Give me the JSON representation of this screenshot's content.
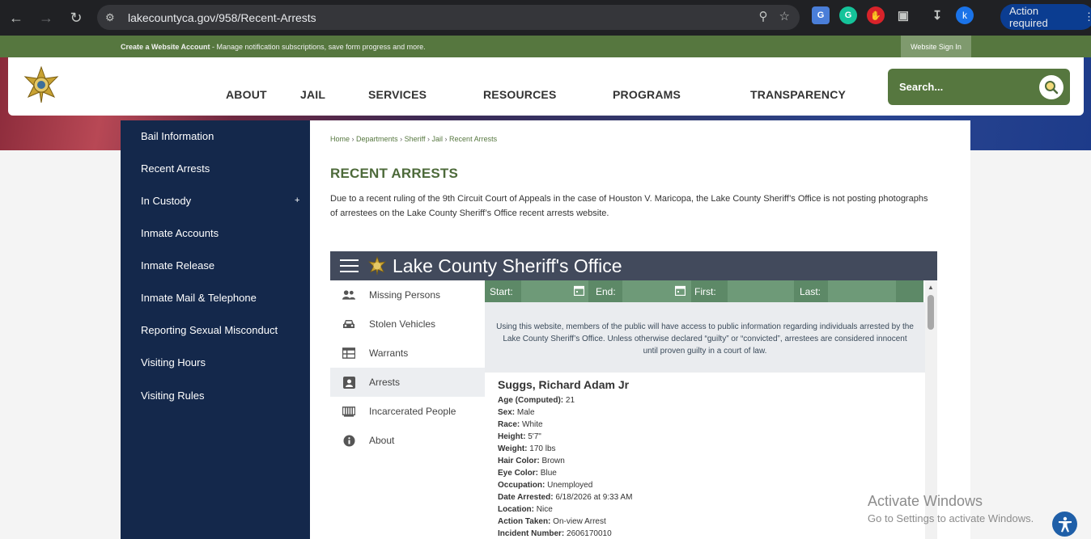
{
  "browser": {
    "url": "lakecountyca.gov/958/Recent-Arrests",
    "avatar_letter": "k",
    "action_required": "Action required"
  },
  "account_bar": {
    "create_bold": "Create a Website Account",
    "create_rest": " - Manage notification subscriptions, save form progress and more.",
    "sign_in": "Website Sign In"
  },
  "nav": {
    "about": "ABOUT",
    "jail": "JAIL",
    "services": "SERVICES",
    "resources": "RESOURCES",
    "programs": "PROGRAMS",
    "transparency": "TRANSPARENCY",
    "search_placeholder": "Search..."
  },
  "sidebar": {
    "items": [
      {
        "label": "Bail Information"
      },
      {
        "label": "Recent Arrests"
      },
      {
        "label": "In Custody",
        "expander": "+"
      },
      {
        "label": "Inmate Accounts"
      },
      {
        "label": "Inmate Release"
      },
      {
        "label": "Inmate Mail & Telephone"
      },
      {
        "label": "Reporting Sexual Misconduct"
      },
      {
        "label": "Visiting Hours"
      },
      {
        "label": "Visiting Rules"
      }
    ]
  },
  "breadcrumb": [
    "Home",
    "Departments",
    "Sheriff",
    "Jail",
    "Recent Arrests"
  ],
  "breadcrumb_sep": "›",
  "page": {
    "title": "RECENT ARRESTS",
    "intro": "Due to a recent ruling of the 9th Circuit Court of Appeals in the case of Houston V. Maricopa, the Lake County Sheriff’s Office is not posting photographs of arrestees on the Lake County Sheriff’s Office recent arrests website."
  },
  "app": {
    "title": "Lake County Sheriff's Office",
    "menu": [
      {
        "label": "Missing Persons",
        "icon": "people-icon"
      },
      {
        "label": "Stolen Vehicles",
        "icon": "car-icon"
      },
      {
        "label": "Warrants",
        "icon": "warrant-table-icon"
      },
      {
        "label": "Arrests",
        "icon": "id-badge-icon",
        "active": true
      },
      {
        "label": "Incarcerated People",
        "icon": "jail-cell-icon"
      },
      {
        "label": "About",
        "icon": "info-icon"
      }
    ],
    "filters": {
      "start": "Start:",
      "end": "End:",
      "first": "First:",
      "last": "Last:"
    },
    "notice": "Using this website, members of the public will have access to public information regarding individuals arrested by the Lake County Sheriff’s Office. Unless otherwise declared “guilty” or “convicted”, arrestees are considered innocent until proven guilty in a court of law.",
    "record": {
      "name": "Suggs, Richard Adam Jr",
      "fields": [
        {
          "label": "Age (Computed):",
          "value": "21"
        },
        {
          "label": "Sex:",
          "value": "Male"
        },
        {
          "label": "Race:",
          "value": "White"
        },
        {
          "label": "Height:",
          "value": "5'7\""
        },
        {
          "label": "Weight:",
          "value": "170 lbs"
        },
        {
          "label": "Hair Color:",
          "value": "Brown"
        },
        {
          "label": "Eye Color:",
          "value": "Blue"
        },
        {
          "label": "Occupation:",
          "value": "Unemployed"
        },
        {
          "label": "Date Arrested:",
          "value": "6/18/2026 at 9:33 AM"
        },
        {
          "label": "Location:",
          "value": "Nice"
        },
        {
          "label": "Action Taken:",
          "value": "On-view Arrest"
        },
        {
          "label": "Incident Number:",
          "value": "2606170010"
        }
      ]
    }
  },
  "overlay": {
    "activate_title": "Activate Windows",
    "activate_sub": "Go to Settings to activate Windows."
  },
  "colors": {
    "brand_green": "#56773f",
    "sidebar_navy": "#14284b",
    "app_header": "#424a5c"
  }
}
